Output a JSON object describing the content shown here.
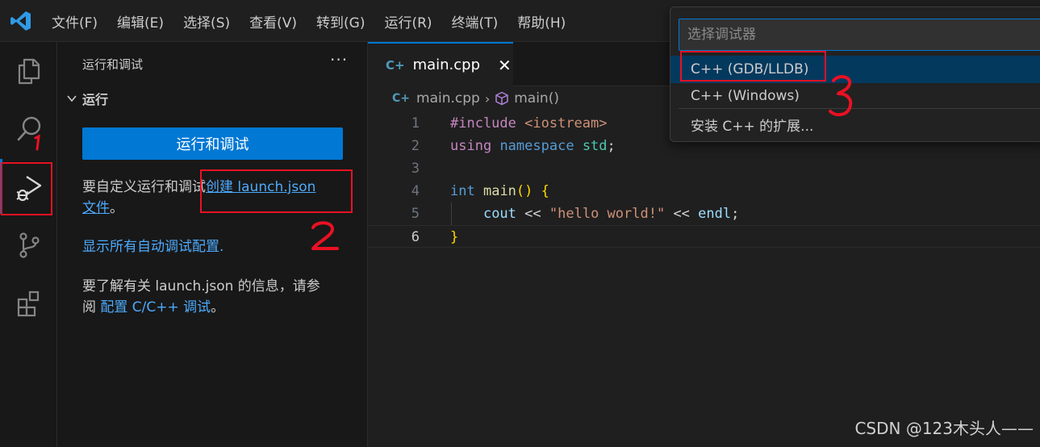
{
  "menu": [
    "文件(F)",
    "编辑(E)",
    "选择(S)",
    "查看(V)",
    "转到(G)",
    "运行(R)",
    "终端(T)",
    "帮助(H)"
  ],
  "activity_icons": [
    "explorer-icon",
    "search-icon",
    "run-debug-icon",
    "source-control-icon",
    "extensions-icon"
  ],
  "sidebar": {
    "title": "运行和调试",
    "more": "···",
    "section": "运行",
    "run_button": "运行和调试",
    "custom_prefix": "要自定义运行和调试",
    "create_link": "创建 launch.json",
    "file_link": "文件",
    "period": "。",
    "show_all": "显示所有自动调试配置.",
    "learn_prefix": "要了解有关 launch.json 的信息，请参",
    "learn_prefix2": "阅",
    "learn_link": "配置 C/C++ 调试",
    "learn_suffix": "。"
  },
  "editor": {
    "tab_icon": "C+",
    "tab_name": "main.cpp",
    "tab_close": "✕",
    "breadcrumb_file": "main.cpp",
    "breadcrumb_symbol": "main()",
    "line_numbers": [
      "1",
      "2",
      "3",
      "4",
      "5",
      "6"
    ],
    "code": {
      "l1_inc": "#include",
      "l1_hdr": "<iostream>",
      "l2_using": "using",
      "l2_namespace": "namespace",
      "l2_std": "std",
      "l2_semi": ";",
      "l4_int": "int",
      "l4_main": "main",
      "l4_paren": "()",
      "l4_brace": "{",
      "l5_cout": "cout",
      "l5_op1": "<<",
      "l5_str": "\"hello world!\"",
      "l5_op2": "<<",
      "l5_endl": "endl",
      "l5_semi": ";",
      "l6_brace": "}"
    }
  },
  "quickpick": {
    "placeholder": "选择调试器",
    "items": [
      "C++ (GDB/LLDB)",
      "C++ (Windows)",
      "安装 C++ 的扩展..."
    ]
  },
  "annotations": [
    "1",
    "2",
    "3"
  ],
  "watermark": "CSDN @123木头人——",
  "colors": {
    "accent": "#0078d4",
    "annotation": "#e81123",
    "link": "#4daafc"
  }
}
